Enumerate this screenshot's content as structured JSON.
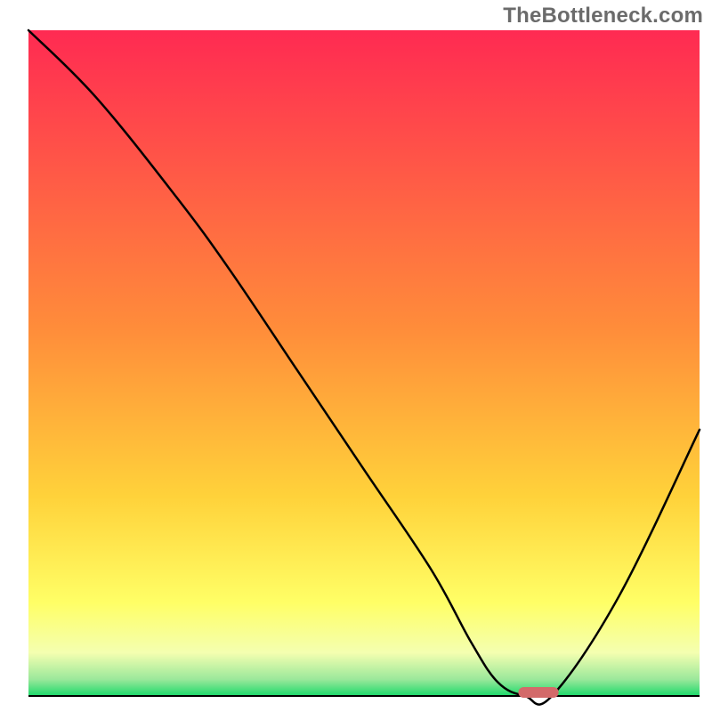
{
  "watermark": "TheBottleneck.com",
  "chart_data": {
    "type": "line",
    "title": "",
    "xlabel": "",
    "ylabel": "",
    "xlim": [
      0,
      100
    ],
    "ylim": [
      0,
      100
    ],
    "grid": false,
    "legend": false,
    "annotations": [],
    "axes": {
      "show_ticks": false,
      "show_xaxis": true,
      "show_left_axis": false,
      "show_right_axis": false,
      "show_top_axis": false
    },
    "gradient_background": {
      "stops": [
        {
          "offset": 0.0,
          "color": "#ff2a52"
        },
        {
          "offset": 0.45,
          "color": "#ff8d3a"
        },
        {
          "offset": 0.7,
          "color": "#ffd23a"
        },
        {
          "offset": 0.86,
          "color": "#ffff66"
        },
        {
          "offset": 0.935,
          "color": "#f4ffb0"
        },
        {
          "offset": 0.975,
          "color": "#9be89b"
        },
        {
          "offset": 1.0,
          "color": "#1bd96a"
        }
      ]
    },
    "series": [
      {
        "name": "bottleneck-curve",
        "color": "#000000",
        "stroke_width": 2.5,
        "x": [
          0,
          10,
          22,
          30,
          40,
          50,
          60,
          66,
          70,
          74,
          78,
          88,
          100
        ],
        "y": [
          100,
          90,
          75,
          64,
          49,
          34,
          19,
          8,
          2,
          0,
          0,
          15,
          40
        ]
      }
    ],
    "marker": {
      "name": "optimal-point",
      "shape": "rounded-rect",
      "x_center": 76,
      "y": 0,
      "width": 6,
      "height": 1.6,
      "color": "#d36a6a"
    }
  }
}
